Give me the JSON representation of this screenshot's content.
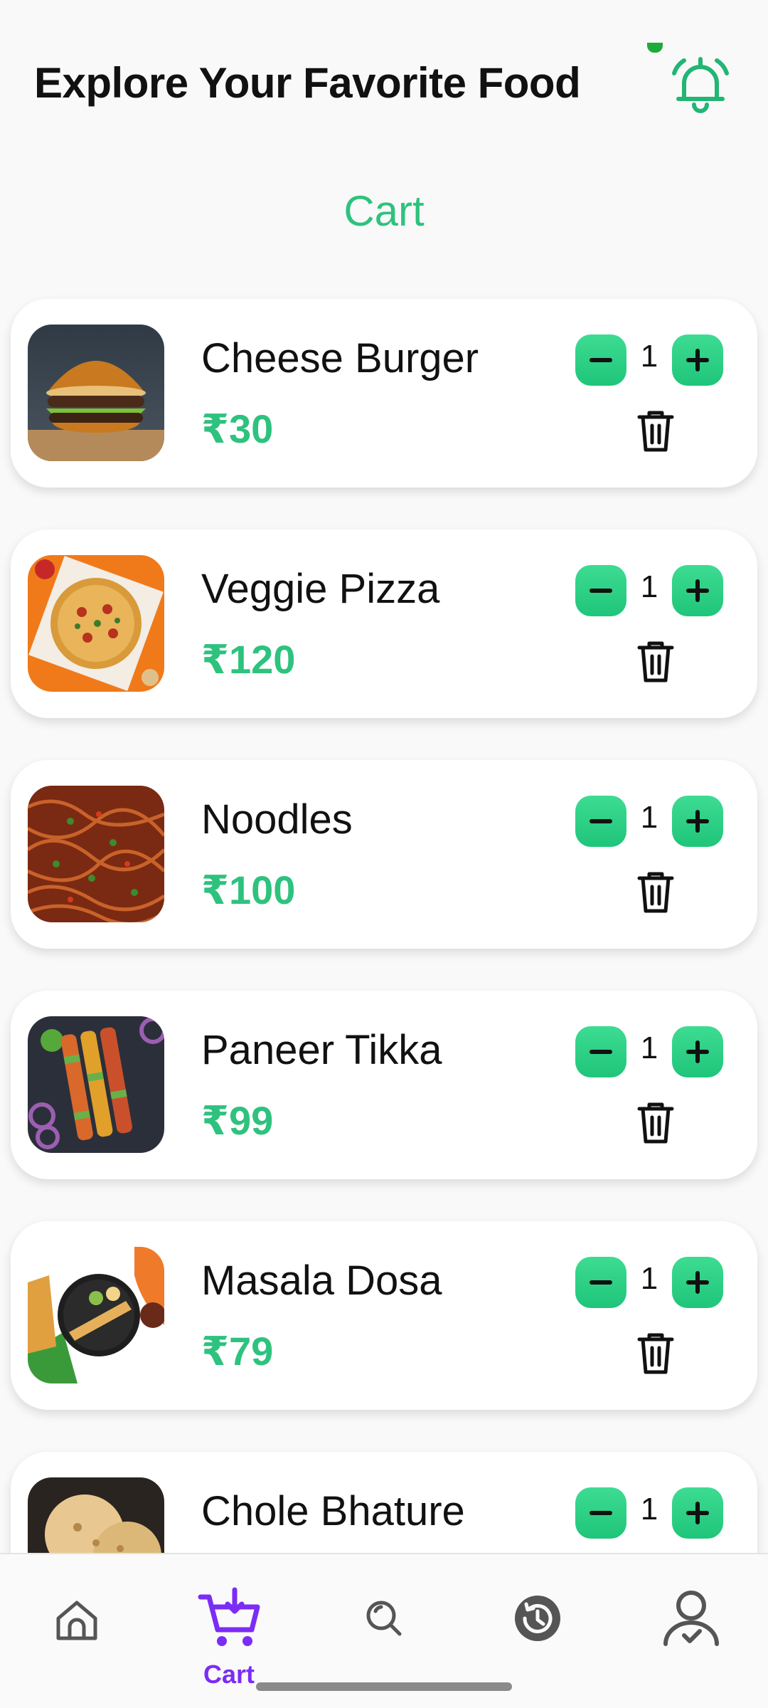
{
  "header": {
    "title": "Explore Your Favorite Food"
  },
  "page": {
    "heading": "Cart"
  },
  "cart": {
    "items": [
      {
        "name": "Cheese Burger",
        "price": "₹30",
        "qty": "1"
      },
      {
        "name": "Veggie Pizza",
        "price": "₹120",
        "qty": "1"
      },
      {
        "name": "Noodles",
        "price": "₹100",
        "qty": "1"
      },
      {
        "name": "Paneer Tikka",
        "price": "₹99",
        "qty": "1"
      },
      {
        "name": "Masala Dosa",
        "price": "₹79",
        "qty": "1"
      },
      {
        "name": "Chole Bhature",
        "price": "",
        "qty": "1"
      }
    ]
  },
  "nav": {
    "items": [
      {
        "icon": "home-icon",
        "label": ""
      },
      {
        "icon": "cart-icon",
        "label": "Cart"
      },
      {
        "icon": "search-icon",
        "label": ""
      },
      {
        "icon": "history-icon",
        "label": ""
      },
      {
        "icon": "profile-icon",
        "label": ""
      }
    ],
    "active_color": "#7b2cf5"
  },
  "colors": {
    "accent": "#2ec27e",
    "bell": "#22b573"
  }
}
